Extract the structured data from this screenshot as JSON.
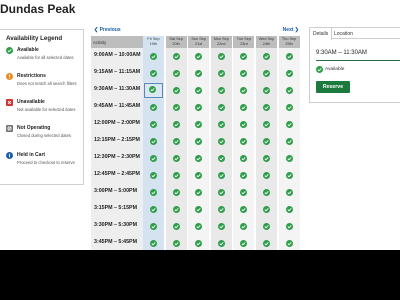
{
  "page": {
    "title": "Dundas Peak"
  },
  "legend": {
    "title": "Availability Legend",
    "items": [
      {
        "icon": "available-icon",
        "color": "#2e9e4a",
        "label": "Available",
        "desc": "Available for all selected dates"
      },
      {
        "icon": "restrictions-icon",
        "color": "#e88c1f",
        "label": "Restrictions",
        "desc": "Does not match all search filters"
      },
      {
        "icon": "unavailable-icon",
        "color": "#d33434",
        "label": "Unavailable",
        "desc": "Not available for selected dates"
      },
      {
        "icon": "not-operating-icon",
        "color": "#777777",
        "label": "Not Operating",
        "desc": "Closed during selected dates"
      },
      {
        "icon": "held-in-cart-icon",
        "color": "#1a5ea8",
        "label": "Held in Cart",
        "desc": "Proceed to checkout to reserve"
      }
    ]
  },
  "grid": {
    "prev_label": "❮ Previous",
    "next_label": "Next ❯",
    "activity_header": "Activity",
    "days": [
      {
        "line1": "Fri Sep",
        "line2": "19th"
      },
      {
        "line1": "Sat Sep",
        "line2": "20th"
      },
      {
        "line1": "Sun Sep",
        "line2": "21st"
      },
      {
        "line1": "Mon Sep",
        "line2": "22nd"
      },
      {
        "line1": "Tue Sep",
        "line2": "23rd"
      },
      {
        "line1": "Wed Sep",
        "line2": "24th"
      },
      {
        "line1": "Thu Sep",
        "line2": "25th"
      }
    ],
    "rows": [
      {
        "time": "9:00AM – 10:00AM"
      },
      {
        "time": "9:15AM – 11:15AM"
      },
      {
        "time": "9:30AM – 11:30AM",
        "selected": true
      },
      {
        "time": "9:45AM – 11:45AM"
      },
      {
        "time": "12:00PM – 2:00PM"
      },
      {
        "time": "12:15PM – 2:15PM"
      },
      {
        "time": "12:30PM – 2:30PM"
      },
      {
        "time": "12:45PM – 2:45PM"
      },
      {
        "time": "3:00PM – 5:00PM"
      },
      {
        "time": "3:15PM – 5:15PM"
      },
      {
        "time": "3:30PM – 5:30PM"
      },
      {
        "time": "3:45PM – 5:45PM"
      }
    ],
    "status": "available",
    "status_color": "#2e9e4a"
  },
  "details": {
    "tabs": [
      "Details",
      "Location"
    ],
    "active_tab": "Details",
    "time": "9:30AM – 11:30AM",
    "status_label": "Available",
    "reserve_label": "Reserve",
    "accent_color": "#1d7a3f"
  }
}
